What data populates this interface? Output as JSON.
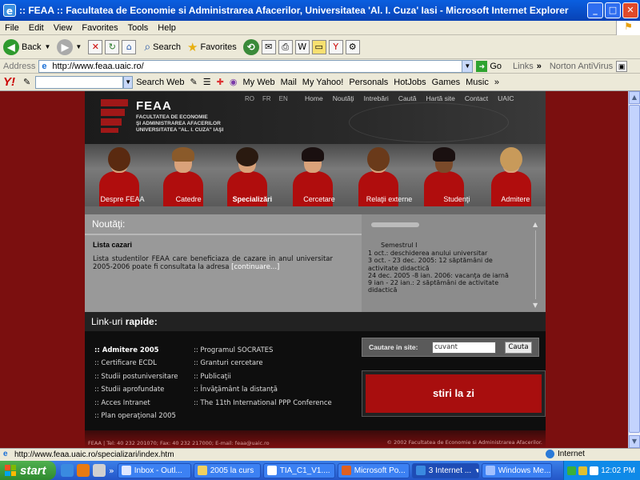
{
  "window": {
    "title": ":: FEAA :: Facultatea de Economie si Administrarea Afacerilor, Universitatea 'Al. I. Cuza' Iasi - Microsoft Internet Explorer"
  },
  "menu": [
    "File",
    "Edit",
    "View",
    "Favorites",
    "Tools",
    "Help"
  ],
  "toolbar": {
    "back": "Back",
    "search": "Search",
    "favorites": "Favorites"
  },
  "address": {
    "label": "Address",
    "url": "http://www.feaa.uaic.ro/",
    "go": "Go",
    "links": "Links",
    "norton": "Norton AntiVirus"
  },
  "yahoo": {
    "search_web": "Search Web",
    "items": [
      "My Web",
      "Mail",
      "My Yahoo!",
      "Personals",
      "HotJobs",
      "Games",
      "Music"
    ]
  },
  "site": {
    "logo_title": "FEAA",
    "logo_sub": "FACULTATEA DE ECONOMIE\nŞI ADMINISTRAREA AFACERILOR\nUNIVERSITATEA \"AL. I. CUZA\" IAŞI",
    "languages": [
      "RO",
      "FR",
      "EN"
    ],
    "top_nav": [
      "Home",
      "Noutăţi",
      "Intrebări",
      "Caută",
      "Hartă site",
      "Contact",
      "UAIC"
    ],
    "categories": [
      "Despre FEAA",
      "Catedre",
      "Specializări",
      "Cercetare",
      "Relaţii externe",
      "Studenţi",
      "Admitere"
    ],
    "active_category": "Specializări",
    "news": {
      "heading": "Noutăţi:",
      "item_title": "Lista cazari",
      "item_text": "Lista studentilor FEAA care beneficiaza de cazare in anul universitar 2005-2006 poate fi consultata la adresa",
      "more": "[continuare...]"
    },
    "calendar": {
      "semester": "Semestrul I",
      "lines": [
        "1 oct.: deschiderea anului universitar",
        "3 oct. - 23 dec. 2005: 12 săptămâni de activitate didactică",
        "24 dec. 2005 -8 ian. 2006: vacanţa de iarnă",
        "9 ian - 22 ian.: 2 săptămâni de activitate didactică"
      ]
    },
    "links_heading_a": "Link-uri ",
    "links_heading_b": "rapide:",
    "links_left": [
      ":: Admitere 2005",
      ":: Certificare ECDL",
      ":: Studii postuniversitare",
      ":: Studii aprofundate",
      ":: Acces Intranet",
      ":: Plan operaţional 2005"
    ],
    "links_right": [
      ":: Programul SOCRATES",
      ":: Granturi cercetare",
      ":: Publicaţii",
      ":: Învăţământ la distanţă",
      ":: The 11th International PPP Conference"
    ],
    "search_label": "Cautare in site:",
    "search_value": "cuvant",
    "search_button": "Cauta",
    "stiri": "stiri la zi",
    "footer_left": "FEAA | Tel: 40 232 201070; Fax: 40 232 217000; E-mail: feaa@uaic.ro",
    "footer_right": "© 2002 Facultatea de Economie si Administrarea Afacerilor."
  },
  "status": {
    "url": "http://www.feaa.uaic.ro/specializari/index.htm",
    "zone": "Internet"
  },
  "taskbar": {
    "start": "start",
    "tasks": [
      "Inbox - Outl...",
      "2005 la curs",
      "TIA_C1_V1....",
      "Microsoft Po...",
      "3 Internet ...",
      "Windows Me..."
    ],
    "clock": "12:02 PM"
  }
}
